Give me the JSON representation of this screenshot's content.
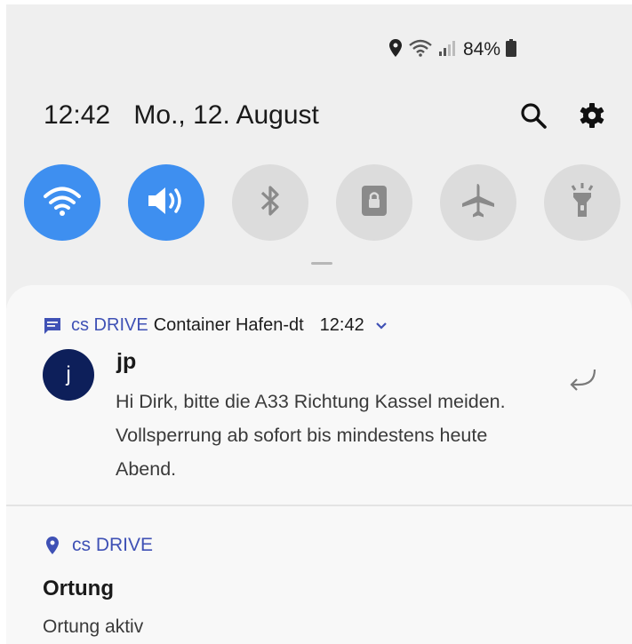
{
  "status_bar": {
    "battery_percent": "84%",
    "icons": [
      "location-icon",
      "wifi-icon",
      "signal-icon",
      "battery-icon"
    ]
  },
  "header": {
    "time": "12:42",
    "date": "Mo., 12. August"
  },
  "quick_settings": [
    {
      "name": "wifi",
      "icon": "wifi-icon",
      "state": "on"
    },
    {
      "name": "sound",
      "icon": "speaker-icon",
      "state": "on"
    },
    {
      "name": "bluetooth",
      "icon": "bluetooth-icon",
      "state": "off"
    },
    {
      "name": "screen-lock",
      "icon": "lock-rotation-icon",
      "state": "off"
    },
    {
      "name": "airplane",
      "icon": "airplane-icon",
      "state": "off"
    },
    {
      "name": "flashlight",
      "icon": "flashlight-icon",
      "state": "off"
    }
  ],
  "notification_message": {
    "app_name": "cs DRIVE",
    "subtitle": "Container Hafen-dt",
    "time": "12:42",
    "avatar_letter": "j",
    "sender": "jp",
    "text": "Hi Dirk, bitte die A33 Richtung Kassel meiden. Vollsperrung ab sofort bis mindestens heute Abend."
  },
  "notification_location": {
    "app_name": "cs DRIVE",
    "title": "Ortung",
    "text": "Ortung aktiv"
  },
  "colors": {
    "accent": "#3e8ff0",
    "app_accent": "#3f51b5",
    "avatar": "#0d1f5a"
  }
}
